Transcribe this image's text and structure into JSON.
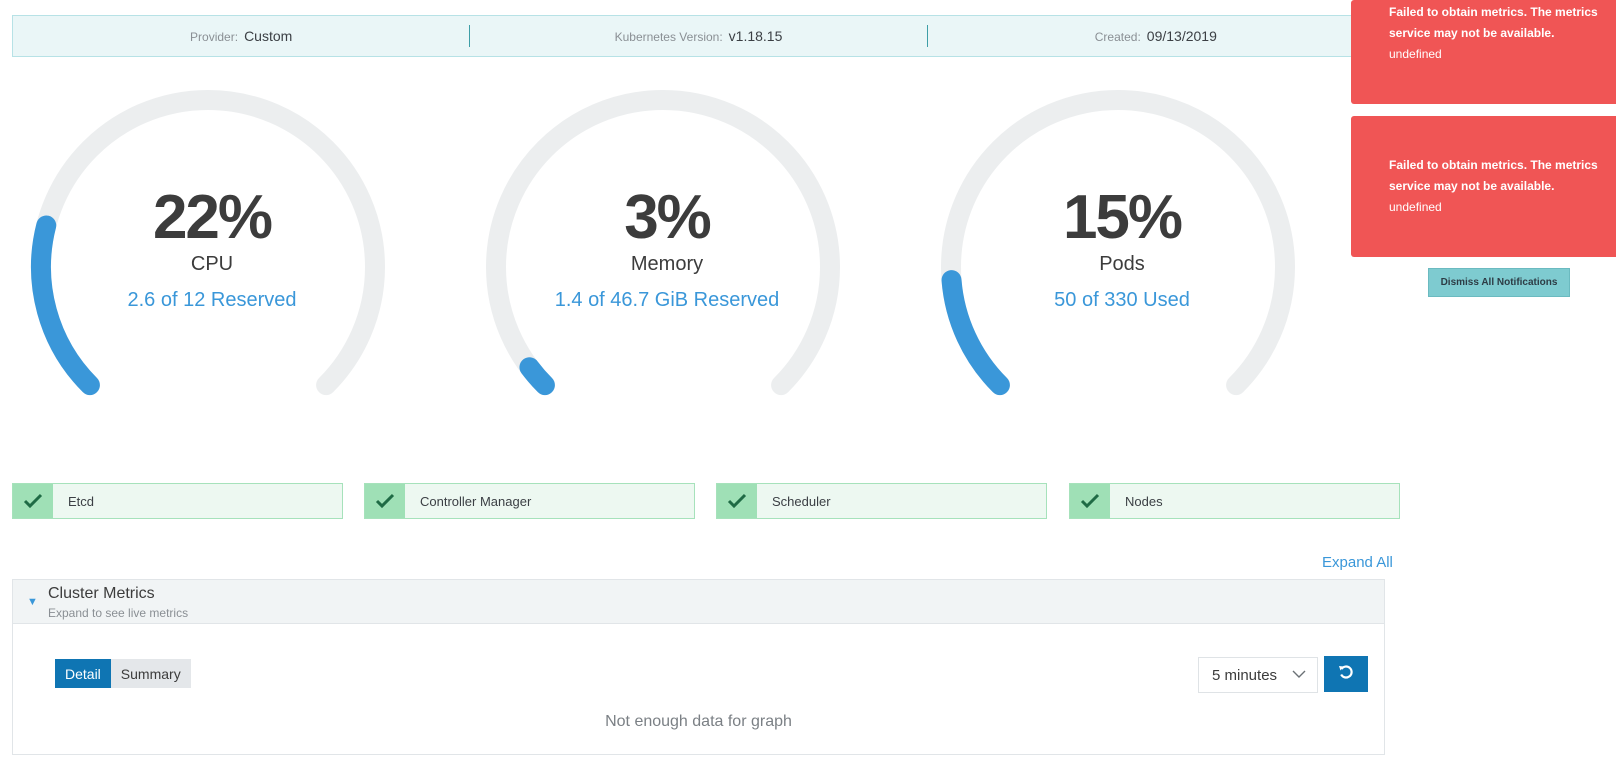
{
  "info": {
    "provider_label": "Provider:",
    "provider_value": "Custom",
    "k8s_label": "Kubernetes Version:",
    "k8s_value": "v1.18.15",
    "created_label": "Created:",
    "created_value": "09/13/2019"
  },
  "gauges": [
    {
      "percent": "22%",
      "label": "CPU",
      "sub": "2.6 of 12 Reserved",
      "fill": 0.22
    },
    {
      "percent": "3%",
      "label": "Memory",
      "sub": "1.4 of 46.7 GiB Reserved",
      "fill": 0.03
    },
    {
      "percent": "15%",
      "label": "Pods",
      "sub": "50 of 330 Used",
      "fill": 0.15
    }
  ],
  "notifications": [
    {
      "message": "Failed to obtain metrics. The metrics service may not be available.",
      "detail": "undefined"
    },
    {
      "message": "Failed to obtain metrics. The metrics service may not be available.",
      "detail": "undefined"
    }
  ],
  "dismiss_label": "Dismiss All Notifications",
  "components": [
    {
      "name": "Etcd"
    },
    {
      "name": "Controller Manager"
    },
    {
      "name": "Scheduler"
    },
    {
      "name": "Nodes"
    }
  ],
  "expand_all": "Expand All",
  "metrics": {
    "title": "Cluster Metrics",
    "hint": "Expand to see live metrics",
    "tab_detail": "Detail",
    "tab_summary": "Summary",
    "range_value": "5 minutes",
    "empty": "Not enough data for graph"
  },
  "colors": {
    "accent": "#3a97d9",
    "track": "#eceeef",
    "error": "#f05555",
    "success": "#9fe0b6",
    "primary_button": "#0f75b3"
  },
  "icons": {
    "check": "check-icon",
    "refresh": "refresh-icon",
    "caret": "caret-down-icon",
    "chevron": "chevron-down-icon"
  }
}
